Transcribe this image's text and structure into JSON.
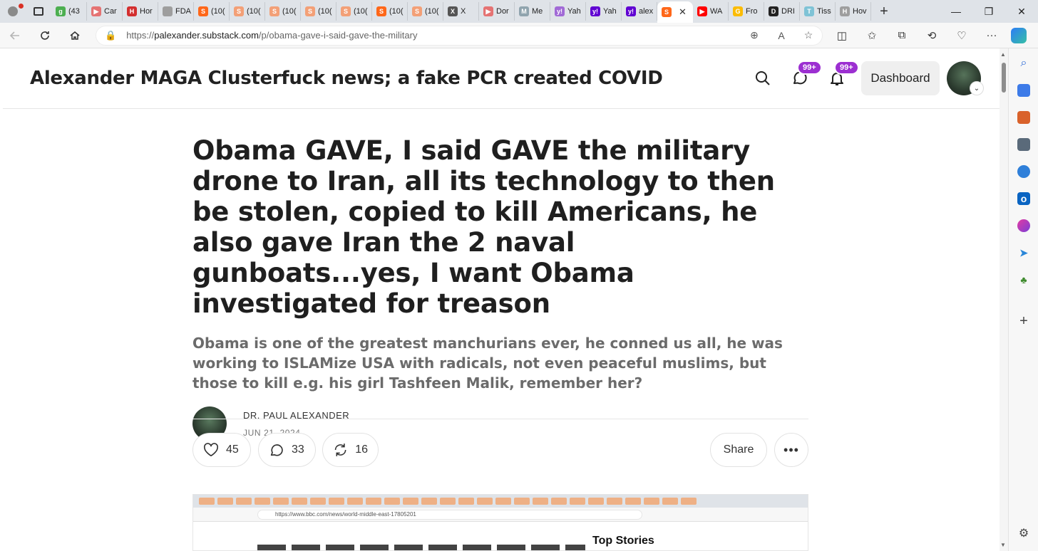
{
  "browser": {
    "tabs": [
      {
        "label": "(43",
        "fav": "g",
        "color": "#4caf50"
      },
      {
        "label": "Car",
        "fav": "▶",
        "color": "#e57373"
      },
      {
        "label": "Hor",
        "fav": "H",
        "color": "#d32f2f"
      },
      {
        "label": "FDA",
        "fav": "",
        "color": "#9e9e9e"
      },
      {
        "label": "(10(",
        "fav": "S",
        "color": "#ff6719"
      },
      {
        "label": "(10(",
        "fav": "S",
        "color": "#f3a077"
      },
      {
        "label": "(10(",
        "fav": "S",
        "color": "#f3a077"
      },
      {
        "label": "(10(",
        "fav": "S",
        "color": "#f3a077"
      },
      {
        "label": "(10(",
        "fav": "S",
        "color": "#f3a077"
      },
      {
        "label": "(10(",
        "fav": "S",
        "color": "#ff6719"
      },
      {
        "label": "(10(",
        "fav": "S",
        "color": "#f3a077"
      },
      {
        "label": "X",
        "fav": "X",
        "color": "#555555"
      },
      {
        "label": "Dor",
        "fav": "▶",
        "color": "#e57373"
      },
      {
        "label": "Me",
        "fav": "M",
        "color": "#90a4ae"
      },
      {
        "label": "Yah",
        "fav": "y!",
        "color": "#a16ad6"
      },
      {
        "label": "Yah",
        "fav": "y!",
        "color": "#6001d2"
      },
      {
        "label": "alex",
        "fav": "y!",
        "color": "#6001d2"
      },
      {
        "label": "",
        "fav": "S",
        "color": "#ff6719",
        "active": true
      },
      {
        "label": "WA",
        "fav": "▶",
        "color": "#ff0000"
      },
      {
        "label": "Fro",
        "fav": "G",
        "color": "#fbbc05"
      },
      {
        "label": "DRI",
        "fav": "D",
        "color": "#222222"
      },
      {
        "label": "Tiss",
        "fav": "T",
        "color": "#7fc3d6"
      },
      {
        "label": "Hov",
        "fav": "H",
        "color": "#9e9e9e"
      }
    ],
    "url_prefix": "https://",
    "url_host": "palexander.substack.com",
    "url_path": "/p/obama-gave-i-said-gave-the-military"
  },
  "header": {
    "site_title": "Alexander MAGA Clusterfuck news; a fake PCR created COVID",
    "chat_badge": "99+",
    "notif_badge": "99+",
    "dashboard_label": "Dashboard"
  },
  "article": {
    "title": "Obama GAVE, I said GAVE the military drone to Iran, all its technology to then be stolen, copied to kill Americans, he also gave Iran the 2 naval gunboats...yes, I want Obama investigated for treason",
    "subtitle": "Obama is one of the greatest manchurians ever, he conned us all, he was working to ISLAMize USA with radicals, not even peaceful muslims, but those to kill e.g. his girl Tashfeen Malik, remember her?",
    "author": "DR. PAUL ALEXANDER",
    "date": "JUN 21, 2024",
    "likes": "45",
    "comments": "33",
    "restacks": "16",
    "share_label": "Share",
    "more_label": "•••"
  },
  "embed": {
    "url": "https://www.bbc.com/news/world-middle-east-17805201",
    "side_heading": "Top Stories"
  },
  "colors": {
    "accent_badge": "#9c2fd1",
    "substack_orange": "#ff6719"
  }
}
